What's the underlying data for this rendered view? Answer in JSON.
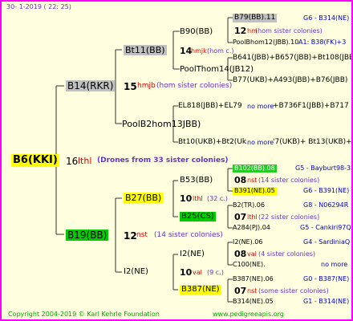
{
  "header": {
    "date": "30-   1-2019 (  22: 25)"
  },
  "root": {
    "name": "B6(KKI)",
    "gen": "16",
    "breeder": "lthl",
    "note": "(Drones from 33 sister colonies)"
  },
  "sire": {
    "name": "B14(RKR)",
    "gen": "15",
    "breeder": "hmjb",
    "note": "(hom sister colonies)"
  },
  "sire_sire": {
    "name": "Bt11(BB)",
    "gen": "14",
    "breeder": "hmjk",
    "note": "(hom c.)"
  },
  "ss_sire": {
    "name": "B90(BB)"
  },
  "ss_dam": {
    "name": "PoolThom14(JB12)"
  },
  "sss": {
    "name": "B79(BB).11",
    "code": "G6 - B314(NE)",
    "gen": "12",
    "breeder": "hm",
    "note": "(hom sister colonies)",
    "dam": "PoolBhom12(JBB).10",
    "dam_info": "A1: B38(FK)+3"
  },
  "ssd": {
    "line1": "B641(JBB)+B657(JBB)+Bt108(JBB)",
    "line2": "B77(UKB)+A493(JBB)+B76(JBB)"
  },
  "sire_dam": {
    "name": "PoolB2hom13JBB)"
  },
  "sd": {
    "line1a": "EL818(JBB)+EL79",
    "line1b": "no more",
    "line1c": "+B736F1(JBB)+B717",
    "line2a": "Bt10(UKB)+Bt2(Uk",
    "line2b": "no more",
    "line2c": "'7(UKB)+ Bt13(UKB)+"
  },
  "dam": {
    "name": "B19(BB)",
    "gen": "12",
    "breeder": "nst",
    "note": "(14 sister colonies)"
  },
  "dam_sire": {
    "name": "B27(BB)",
    "gen": "10",
    "breeder": "lthl",
    "note": "(32 c.)"
  },
  "ds_sire": {
    "name": "B53(BB)"
  },
  "dss": {
    "name": "B102(BB).08",
    "code": "G5 - Bayburt98-3",
    "gen": "08",
    "breeder": "nst",
    "note": "(14 sister colonies)",
    "dam": "B391(NE).05",
    "dam_code": "G6 - B391(NE)"
  },
  "ds_dam": {
    "name": "B25(CS)"
  },
  "dsd": {
    "sire": "B2(TR).06",
    "sire_code": "G8 - N06294R",
    "gen": "07",
    "breeder": "lthl",
    "note": "(22 sister colonies)",
    "dam": "A284(PJ).04",
    "dam_code": "G5 - Cankiri97Q"
  },
  "dam_dam": {
    "name": "I2(NE)",
    "gen": "10",
    "breeder": "val",
    "note": "(9 c.)"
  },
  "dd_sire": {
    "name": "I2(NE)"
  },
  "dds": {
    "sire": "I2(NE).06",
    "sire_code": "G4 - SardiniaQ",
    "gen": "08",
    "breeder": "val",
    "note": "(4 sister colonies)",
    "dam": "C100(NE).",
    "dam_info": "no more"
  },
  "dd_dam": {
    "name": "B387(NE)"
  },
  "ddd": {
    "sire": "B387(NE).06",
    "sire_code": "G0 - B387(NE)",
    "gen": "07",
    "breeder": "nst",
    "note": "(some sister colonies)",
    "dam": "B314(NE).05",
    "dam_code": "G1 - B314(NE)"
  },
  "footer": {
    "copyright": "Copyright 2004-2019 © Karl Kehrle Foundation",
    "url": "www.pedigreeapis.org"
  }
}
